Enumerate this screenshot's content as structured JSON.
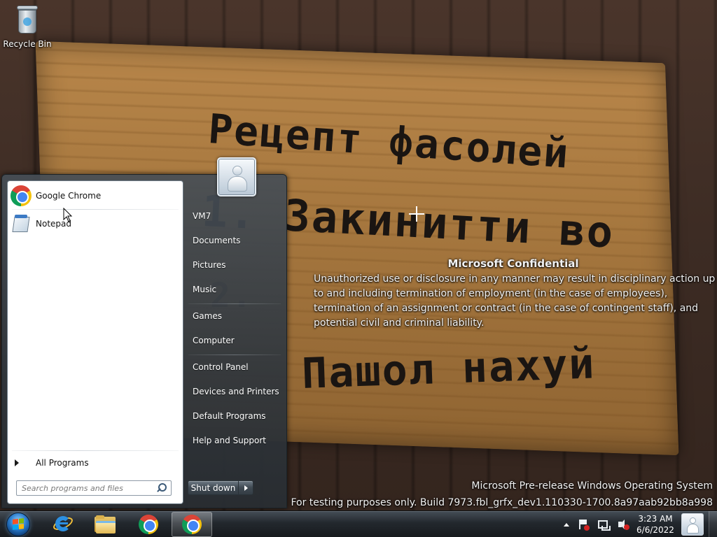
{
  "desktop": {
    "icons": [
      {
        "label": "Recycle Bin",
        "icon": "recycle-bin-icon"
      }
    ],
    "wallpaper": {
      "lines": [
        "Рецепт фасолей",
        "1. Закинитти во",
        "2.",
        "Пашол нахуй"
      ]
    }
  },
  "watermark": {
    "confidential_title": "Microsoft Confidential",
    "confidential_body": "Unauthorized use or disclosure in any manner may result in disciplinary action up to and including termination of employment (in the case of employees), termination of an assignment or contract (in the case of contingent staff), and potential civil and criminal liability.",
    "os_line": "Microsoft Pre-release Windows Operating System",
    "build_line": "For testing purposes only. Build 7973.fbl_grfx_dev1.110330-1700.8a97aab92bb8a998"
  },
  "start_menu": {
    "pinned": [
      {
        "label": "Google Chrome",
        "icon": "chrome-icon"
      },
      {
        "label": "Notepad",
        "icon": "notepad-icon"
      }
    ],
    "all_programs_label": "All Programs",
    "search_placeholder": "Search programs and files",
    "right_items": [
      "VM7",
      "Documents",
      "Pictures",
      "Music",
      "Games",
      "Computer",
      "Control Panel",
      "Devices and Printers",
      "Default Programs",
      "Help and Support"
    ],
    "shutdown_label": "Shut down"
  },
  "taskbar": {
    "apps": [
      {
        "name": "Internet Explorer",
        "icon": "internet-explorer-icon"
      },
      {
        "name": "Windows Explorer",
        "icon": "folder-icon"
      },
      {
        "name": "Google Chrome",
        "icon": "chrome-icon"
      },
      {
        "name": "Google Chrome",
        "icon": "chrome-icon",
        "active": true
      }
    ],
    "tray_icons": [
      "show-hidden-icons-arrow",
      "action-center-flag-icon",
      "network-icon",
      "volume-muted-icon"
    ],
    "clock": {
      "time": "3:23 AM",
      "date": "6/6/2022"
    }
  },
  "colors": {
    "taskbar": "#1e2328",
    "start_menu_frame": "#3a424a",
    "left_pane": "#ffffff",
    "accent_blue": "#2a7ccc"
  }
}
